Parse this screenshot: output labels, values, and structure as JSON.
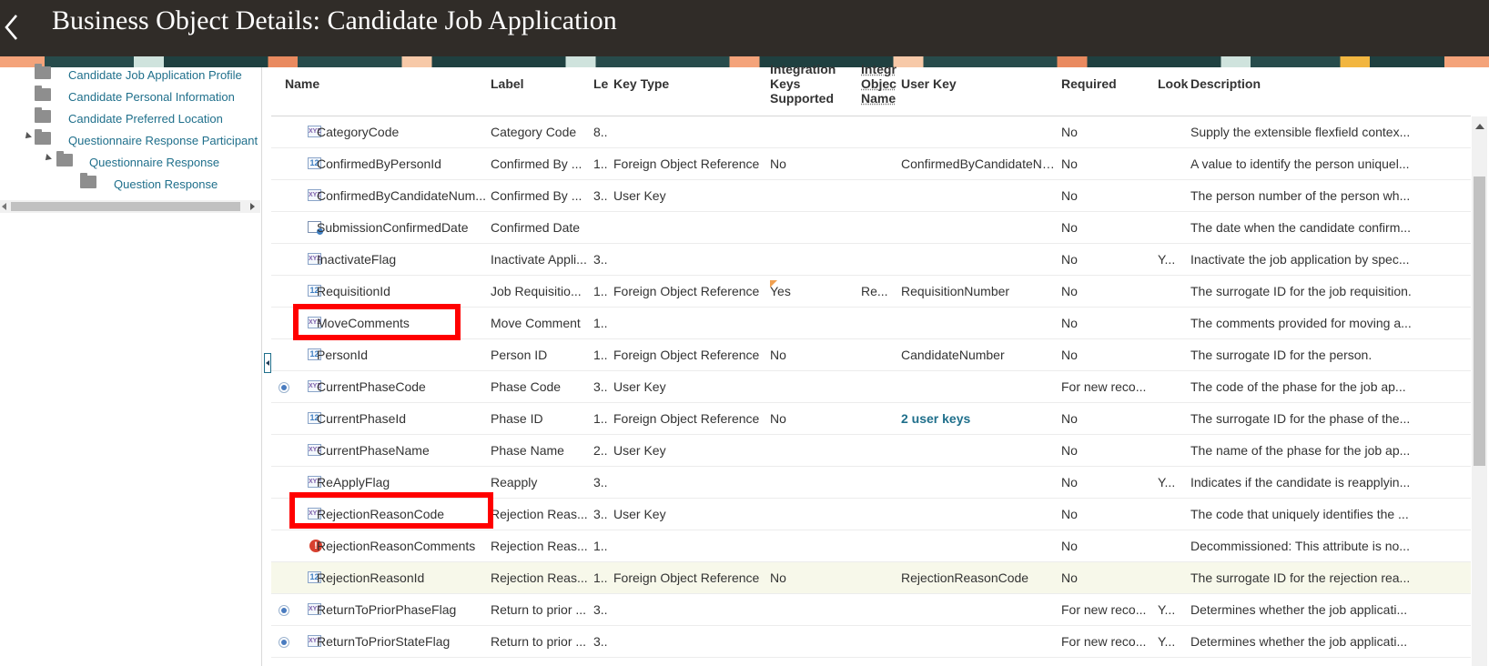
{
  "header": {
    "title": "Business Object Details: Candidate Job Application"
  },
  "tree": {
    "items": [
      {
        "label": "Candidate Job Application Profile"
      },
      {
        "label": "Candidate Personal Information"
      },
      {
        "label": "Candidate Preferred Location"
      },
      {
        "label": "Questionnaire Response Participant"
      },
      {
        "label": "Questionnaire Response"
      },
      {
        "label": "Question Response"
      }
    ]
  },
  "table": {
    "columns": {
      "name": "Name",
      "label": "Label",
      "length": "Le",
      "key_type": "Key Type",
      "integration_keys": [
        "Integration",
        "Keys",
        "Supported"
      ],
      "integration_object": [
        "Integr",
        "Objec",
        "Name"
      ],
      "user_key": "User Key",
      "required": "Required",
      "lookup": "Look",
      "description": "Description"
    },
    "rows": [
      {
        "name": "CategoryCode",
        "icon": "text-attribute-icon",
        "label": "Category Code",
        "length": "8..",
        "key_type": "",
        "integration_keys": "",
        "integration_object": "",
        "user_key": "",
        "required": "No",
        "lookup": "",
        "description": "Supply the extensible flexfield contex..."
      },
      {
        "name": "ConfirmedByPersonId",
        "icon": "number-attribute-icon",
        "label": "Confirmed By ...",
        "length": "1..",
        "key_type": "Foreign Object Reference",
        "integration_keys": "No",
        "integration_object": "",
        "user_key": "ConfirmedByCandidateNu...",
        "required": "No",
        "lookup": "",
        "description": "A value to identify the person uniquel..."
      },
      {
        "name": "ConfirmedByCandidateNum...",
        "icon": "text-attribute-icon",
        "label": "Confirmed By ...",
        "length": "3..",
        "key_type": "User Key",
        "integration_keys": "",
        "integration_object": "",
        "user_key": "",
        "required": "No",
        "lookup": "",
        "description": "The person number of the person wh..."
      },
      {
        "name": "SubmissionConfirmedDate",
        "icon": "date-attribute-icon",
        "label": "Confirmed Date",
        "length": "",
        "key_type": "",
        "integration_keys": "",
        "integration_object": "",
        "user_key": "",
        "required": "No",
        "lookup": "",
        "description": "The date when the candidate confirm..."
      },
      {
        "name": "InactivateFlag",
        "icon": "text-attribute-icon",
        "label": "Inactivate Appli...",
        "length": "3..",
        "key_type": "",
        "integration_keys": "",
        "integration_object": "",
        "user_key": "",
        "required": "No",
        "lookup": "Y...",
        "description": "Inactivate the job application by spec..."
      },
      {
        "name": "RequisitionId",
        "icon": "number-attribute-icon",
        "label": "Job Requisitio...",
        "length": "1..",
        "key_type": "Foreign Object Reference",
        "integration_keys": "Yes",
        "integration_object": "Re...",
        "user_key": "RequisitionNumber",
        "required": "No",
        "lookup": "",
        "description": "The surrogate ID for the job requisition."
      },
      {
        "name": "MoveComments",
        "icon": "text-attribute-icon",
        "label": "Move Comment",
        "length": "1..",
        "key_type": "",
        "integration_keys": "",
        "integration_object": "",
        "user_key": "",
        "required": "No",
        "lookup": "",
        "description": "The comments provided for moving a..."
      },
      {
        "name": "PersonId",
        "icon": "number-attribute-icon",
        "label": "Person ID",
        "length": "1..",
        "key_type": "Foreign Object Reference",
        "integration_keys": "No",
        "integration_object": "",
        "user_key": "CandidateNumber",
        "required": "No",
        "lookup": "",
        "description": "The surrogate ID for the person."
      },
      {
        "name": "CurrentPhaseCode",
        "icon": "text-attribute-icon",
        "label": "Phase Code",
        "length": "3..",
        "key_type": "User Key",
        "integration_keys": "",
        "integration_object": "",
        "user_key": "",
        "required": "For new reco...",
        "lookup": "",
        "description": "The code of the phase for the job ap..."
      },
      {
        "name": "CurrentPhaseId",
        "icon": "number-attribute-icon",
        "label": "Phase ID",
        "length": "1..",
        "key_type": "Foreign Object Reference",
        "integration_keys": "No",
        "integration_object": "",
        "user_key": "2 user keys",
        "required": "No",
        "lookup": "",
        "description": "The surrogate ID for the phase of the..."
      },
      {
        "name": "CurrentPhaseName",
        "icon": "text-attribute-icon",
        "label": "Phase Name",
        "length": "2..",
        "key_type": "User Key",
        "integration_keys": "",
        "integration_object": "",
        "user_key": "",
        "required": "No",
        "lookup": "",
        "description": "The name of the phase for the job ap..."
      },
      {
        "name": "ReApplyFlag",
        "icon": "text-attribute-icon",
        "label": "Reapply",
        "length": "3..",
        "key_type": "",
        "integration_keys": "",
        "integration_object": "",
        "user_key": "",
        "required": "No",
        "lookup": "Y...",
        "description": "Indicates if the candidate is reapplyin..."
      },
      {
        "name": "RejectionReasonCode",
        "icon": "text-attribute-icon",
        "label": "Rejection Reas...",
        "length": "3..",
        "key_type": "User Key",
        "integration_keys": "",
        "integration_object": "",
        "user_key": "",
        "required": "No",
        "lookup": "",
        "description": "The code that uniquely identifies the ..."
      },
      {
        "name": "RejectionReasonComments",
        "icon": "error-icon",
        "label": "Rejection Reas...",
        "length": "1..",
        "key_type": "",
        "integration_keys": "",
        "integration_object": "",
        "user_key": "",
        "required": "No",
        "lookup": "",
        "description": "Decommissioned: This attribute is no..."
      },
      {
        "name": "RejectionReasonId",
        "icon": "number-attribute-icon",
        "label": "Rejection Reas...",
        "length": "1..",
        "key_type": "Foreign Object Reference",
        "integration_keys": "No",
        "integration_object": "",
        "user_key": "RejectionReasonCode",
        "required": "No",
        "lookup": "",
        "description": "The surrogate ID for the rejection rea..."
      },
      {
        "name": "ReturnToPriorPhaseFlag",
        "icon": "text-attribute-icon",
        "label": "Return to prior ...",
        "length": "3..",
        "key_type": "",
        "integration_keys": "",
        "integration_object": "",
        "user_key": "",
        "required": "For new reco...",
        "lookup": "Y...",
        "description": "Determines whether the job applicati..."
      },
      {
        "name": "ReturnToPriorStateFlag",
        "icon": "text-attribute-icon",
        "label": "Return to prior ...",
        "length": "3..",
        "key_type": "",
        "integration_keys": "",
        "integration_object": "",
        "user_key": "",
        "required": "For new reco...",
        "lookup": "Y...",
        "description": "Determines whether the job applicati..."
      }
    ]
  },
  "colors": {
    "header_bg": "#302c28",
    "link": "#1f6f8b",
    "annotation": "#ff0000",
    "row_highlight": "#f7f8ea"
  },
  "icons": {
    "text_attribute": "XYZ",
    "number_attribute": "12",
    "error": "!"
  }
}
